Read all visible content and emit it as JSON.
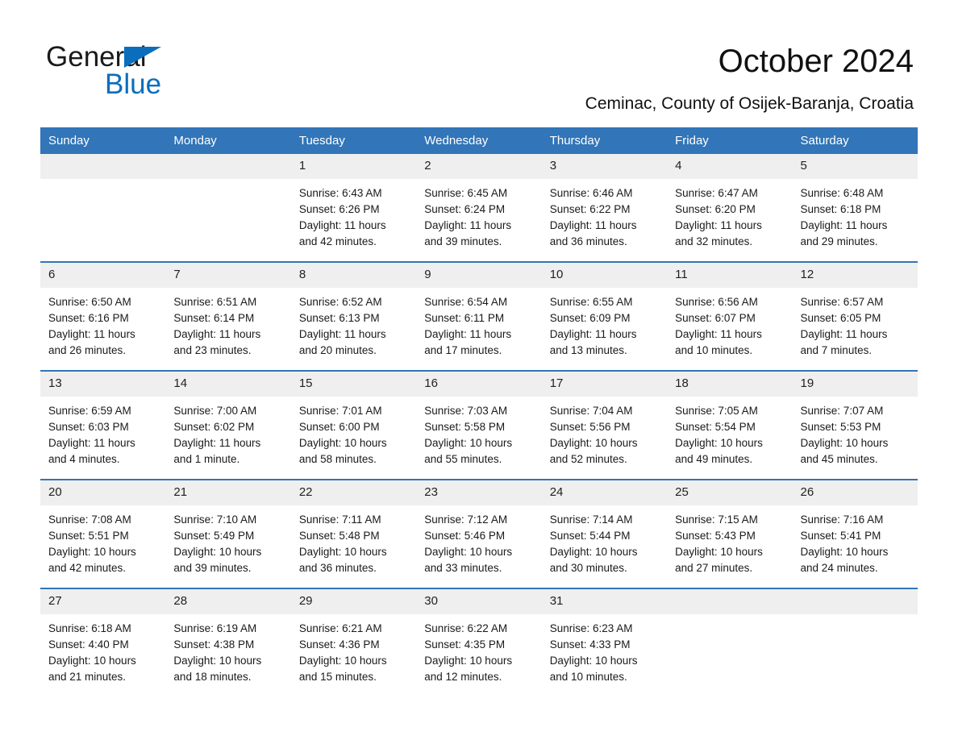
{
  "brand": {
    "name_part1": "General",
    "name_part2": "Blue",
    "triangle_color": "#0a6ebd"
  },
  "header": {
    "title": "October 2024",
    "subtitle": "Ceminac, County of Osijek-Baranja, Croatia",
    "accent_color": "#3275b8",
    "daynum_band_color": "#efefef"
  },
  "weekday_headers": [
    "Sunday",
    "Monday",
    "Tuesday",
    "Wednesday",
    "Thursday",
    "Friday",
    "Saturday"
  ],
  "weeks": [
    [
      {
        "day": "",
        "sunrise": "",
        "sunset": "",
        "daylight1": "",
        "daylight2": ""
      },
      {
        "day": "",
        "sunrise": "",
        "sunset": "",
        "daylight1": "",
        "daylight2": ""
      },
      {
        "day": "1",
        "sunrise": "Sunrise: 6:43 AM",
        "sunset": "Sunset: 6:26 PM",
        "daylight1": "Daylight: 11 hours",
        "daylight2": "and 42 minutes."
      },
      {
        "day": "2",
        "sunrise": "Sunrise: 6:45 AM",
        "sunset": "Sunset: 6:24 PM",
        "daylight1": "Daylight: 11 hours",
        "daylight2": "and 39 minutes."
      },
      {
        "day": "3",
        "sunrise": "Sunrise: 6:46 AM",
        "sunset": "Sunset: 6:22 PM",
        "daylight1": "Daylight: 11 hours",
        "daylight2": "and 36 minutes."
      },
      {
        "day": "4",
        "sunrise": "Sunrise: 6:47 AM",
        "sunset": "Sunset: 6:20 PM",
        "daylight1": "Daylight: 11 hours",
        "daylight2": "and 32 minutes."
      },
      {
        "day": "5",
        "sunrise": "Sunrise: 6:48 AM",
        "sunset": "Sunset: 6:18 PM",
        "daylight1": "Daylight: 11 hours",
        "daylight2": "and 29 minutes."
      }
    ],
    [
      {
        "day": "6",
        "sunrise": "Sunrise: 6:50 AM",
        "sunset": "Sunset: 6:16 PM",
        "daylight1": "Daylight: 11 hours",
        "daylight2": "and 26 minutes."
      },
      {
        "day": "7",
        "sunrise": "Sunrise: 6:51 AM",
        "sunset": "Sunset: 6:14 PM",
        "daylight1": "Daylight: 11 hours",
        "daylight2": "and 23 minutes."
      },
      {
        "day": "8",
        "sunrise": "Sunrise: 6:52 AM",
        "sunset": "Sunset: 6:13 PM",
        "daylight1": "Daylight: 11 hours",
        "daylight2": "and 20 minutes."
      },
      {
        "day": "9",
        "sunrise": "Sunrise: 6:54 AM",
        "sunset": "Sunset: 6:11 PM",
        "daylight1": "Daylight: 11 hours",
        "daylight2": "and 17 minutes."
      },
      {
        "day": "10",
        "sunrise": "Sunrise: 6:55 AM",
        "sunset": "Sunset: 6:09 PM",
        "daylight1": "Daylight: 11 hours",
        "daylight2": "and 13 minutes."
      },
      {
        "day": "11",
        "sunrise": "Sunrise: 6:56 AM",
        "sunset": "Sunset: 6:07 PM",
        "daylight1": "Daylight: 11 hours",
        "daylight2": "and 10 minutes."
      },
      {
        "day": "12",
        "sunrise": "Sunrise: 6:57 AM",
        "sunset": "Sunset: 6:05 PM",
        "daylight1": "Daylight: 11 hours",
        "daylight2": "and 7 minutes."
      }
    ],
    [
      {
        "day": "13",
        "sunrise": "Sunrise: 6:59 AM",
        "sunset": "Sunset: 6:03 PM",
        "daylight1": "Daylight: 11 hours",
        "daylight2": "and 4 minutes."
      },
      {
        "day": "14",
        "sunrise": "Sunrise: 7:00 AM",
        "sunset": "Sunset: 6:02 PM",
        "daylight1": "Daylight: 11 hours",
        "daylight2": "and 1 minute."
      },
      {
        "day": "15",
        "sunrise": "Sunrise: 7:01 AM",
        "sunset": "Sunset: 6:00 PM",
        "daylight1": "Daylight: 10 hours",
        "daylight2": "and 58 minutes."
      },
      {
        "day": "16",
        "sunrise": "Sunrise: 7:03 AM",
        "sunset": "Sunset: 5:58 PM",
        "daylight1": "Daylight: 10 hours",
        "daylight2": "and 55 minutes."
      },
      {
        "day": "17",
        "sunrise": "Sunrise: 7:04 AM",
        "sunset": "Sunset: 5:56 PM",
        "daylight1": "Daylight: 10 hours",
        "daylight2": "and 52 minutes."
      },
      {
        "day": "18",
        "sunrise": "Sunrise: 7:05 AM",
        "sunset": "Sunset: 5:54 PM",
        "daylight1": "Daylight: 10 hours",
        "daylight2": "and 49 minutes."
      },
      {
        "day": "19",
        "sunrise": "Sunrise: 7:07 AM",
        "sunset": "Sunset: 5:53 PM",
        "daylight1": "Daylight: 10 hours",
        "daylight2": "and 45 minutes."
      }
    ],
    [
      {
        "day": "20",
        "sunrise": "Sunrise: 7:08 AM",
        "sunset": "Sunset: 5:51 PM",
        "daylight1": "Daylight: 10 hours",
        "daylight2": "and 42 minutes."
      },
      {
        "day": "21",
        "sunrise": "Sunrise: 7:10 AM",
        "sunset": "Sunset: 5:49 PM",
        "daylight1": "Daylight: 10 hours",
        "daylight2": "and 39 minutes."
      },
      {
        "day": "22",
        "sunrise": "Sunrise: 7:11 AM",
        "sunset": "Sunset: 5:48 PM",
        "daylight1": "Daylight: 10 hours",
        "daylight2": "and 36 minutes."
      },
      {
        "day": "23",
        "sunrise": "Sunrise: 7:12 AM",
        "sunset": "Sunset: 5:46 PM",
        "daylight1": "Daylight: 10 hours",
        "daylight2": "and 33 minutes."
      },
      {
        "day": "24",
        "sunrise": "Sunrise: 7:14 AM",
        "sunset": "Sunset: 5:44 PM",
        "daylight1": "Daylight: 10 hours",
        "daylight2": "and 30 minutes."
      },
      {
        "day": "25",
        "sunrise": "Sunrise: 7:15 AM",
        "sunset": "Sunset: 5:43 PM",
        "daylight1": "Daylight: 10 hours",
        "daylight2": "and 27 minutes."
      },
      {
        "day": "26",
        "sunrise": "Sunrise: 7:16 AM",
        "sunset": "Sunset: 5:41 PM",
        "daylight1": "Daylight: 10 hours",
        "daylight2": "and 24 minutes."
      }
    ],
    [
      {
        "day": "27",
        "sunrise": "Sunrise: 6:18 AM",
        "sunset": "Sunset: 4:40 PM",
        "daylight1": "Daylight: 10 hours",
        "daylight2": "and 21 minutes."
      },
      {
        "day": "28",
        "sunrise": "Sunrise: 6:19 AM",
        "sunset": "Sunset: 4:38 PM",
        "daylight1": "Daylight: 10 hours",
        "daylight2": "and 18 minutes."
      },
      {
        "day": "29",
        "sunrise": "Sunrise: 6:21 AM",
        "sunset": "Sunset: 4:36 PM",
        "daylight1": "Daylight: 10 hours",
        "daylight2": "and 15 minutes."
      },
      {
        "day": "30",
        "sunrise": "Sunrise: 6:22 AM",
        "sunset": "Sunset: 4:35 PM",
        "daylight1": "Daylight: 10 hours",
        "daylight2": "and 12 minutes."
      },
      {
        "day": "31",
        "sunrise": "Sunrise: 6:23 AM",
        "sunset": "Sunset: 4:33 PM",
        "daylight1": "Daylight: 10 hours",
        "daylight2": "and 10 minutes."
      },
      {
        "day": "",
        "sunrise": "",
        "sunset": "",
        "daylight1": "",
        "daylight2": ""
      },
      {
        "day": "",
        "sunrise": "",
        "sunset": "",
        "daylight1": "",
        "daylight2": ""
      }
    ]
  ]
}
